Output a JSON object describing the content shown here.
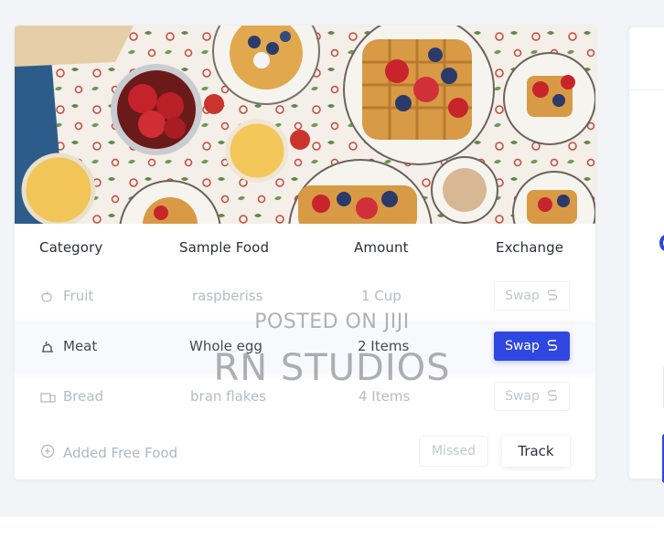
{
  "table": {
    "headers": {
      "category": "Category",
      "sample_food": "Sample Food",
      "amount": "Amount",
      "exchange": "Exchange"
    },
    "rows": [
      {
        "category": "Fruit",
        "icon": "apple-icon",
        "food": "raspberiss",
        "amount": "1 Cup",
        "action": "Swap",
        "state": "inactive"
      },
      {
        "category": "Meat",
        "icon": "meat-icon",
        "food": "Whole egg",
        "amount": "2 Items",
        "action": "Swap",
        "state": "active"
      },
      {
        "category": "Bread",
        "icon": "bread-icon",
        "food": "bran flakes",
        "amount": "4 Items",
        "action": "Swap",
        "state": "inactive"
      }
    ]
  },
  "footer": {
    "added_label": "Added Free Food",
    "missed_label": "Missed",
    "track_label": "Track"
  },
  "watermark": {
    "line1": "POSTED ON JIJI",
    "line2": "RN STUDIOS"
  },
  "colors": {
    "accent": "#2f47e0",
    "background": "#f3f4f8"
  }
}
